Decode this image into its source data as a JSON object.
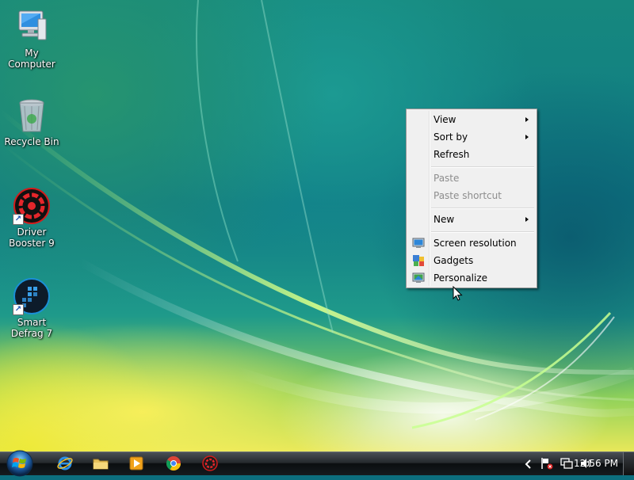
{
  "desktop": {
    "icons": [
      {
        "label": "My Computer",
        "icon": "computer-icon"
      },
      {
        "label": "Recycle Bin",
        "icon": "recycle-bin-icon"
      },
      {
        "label": "Driver Booster 9",
        "icon": "driver-booster-icon"
      },
      {
        "label": "Smart Defrag 7",
        "icon": "smart-defrag-icon"
      }
    ]
  },
  "context_menu": {
    "items": [
      {
        "label": "View",
        "submenu": true,
        "disabled": false
      },
      {
        "label": "Sort by",
        "submenu": true,
        "disabled": false
      },
      {
        "label": "Refresh",
        "submenu": false,
        "disabled": false
      },
      {
        "label": "Paste",
        "submenu": false,
        "disabled": true
      },
      {
        "label": "Paste shortcut",
        "submenu": false,
        "disabled": true
      },
      {
        "label": "New",
        "submenu": true,
        "disabled": false
      },
      {
        "label": "Screen resolution",
        "icon": "monitor-icon",
        "submenu": false,
        "disabled": false
      },
      {
        "label": "Gadgets",
        "icon": "gadgets-icon",
        "submenu": false,
        "disabled": false
      },
      {
        "label": "Personalize",
        "icon": "personalize-icon",
        "submenu": false,
        "disabled": false
      }
    ]
  },
  "taskbar": {
    "start_icon": "windows-orb-icon",
    "pinned": [
      {
        "icon": "internet-explorer-icon"
      },
      {
        "icon": "file-explorer-icon"
      },
      {
        "icon": "media-player-icon"
      },
      {
        "icon": "chrome-icon"
      },
      {
        "icon": "driver-booster-icon"
      }
    ],
    "tray_icons": [
      "chevron-left-icon",
      "action-center-flag-icon",
      "network-icon",
      "volume-icon"
    ],
    "clock": "12:56 PM"
  },
  "colors": {
    "menu_bg": "#f0f0f0",
    "disabled_text": "#8d8d8d",
    "taskbar_dark": "#151a1e"
  }
}
